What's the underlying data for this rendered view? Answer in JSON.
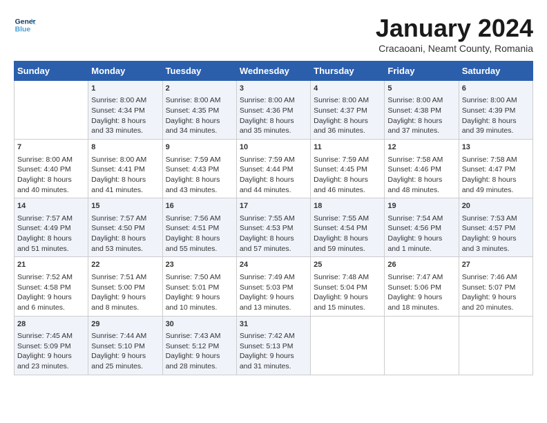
{
  "header": {
    "logo_line1": "General",
    "logo_line2": "Blue",
    "month_title": "January 2024",
    "subtitle": "Cracaoani, Neamt County, Romania"
  },
  "days_of_week": [
    "Sunday",
    "Monday",
    "Tuesday",
    "Wednesday",
    "Thursday",
    "Friday",
    "Saturday"
  ],
  "weeks": [
    [
      {
        "day": "",
        "content": ""
      },
      {
        "day": "1",
        "content": "Sunrise: 8:00 AM\nSunset: 4:34 PM\nDaylight: 8 hours\nand 33 minutes."
      },
      {
        "day": "2",
        "content": "Sunrise: 8:00 AM\nSunset: 4:35 PM\nDaylight: 8 hours\nand 34 minutes."
      },
      {
        "day": "3",
        "content": "Sunrise: 8:00 AM\nSunset: 4:36 PM\nDaylight: 8 hours\nand 35 minutes."
      },
      {
        "day": "4",
        "content": "Sunrise: 8:00 AM\nSunset: 4:37 PM\nDaylight: 8 hours\nand 36 minutes."
      },
      {
        "day": "5",
        "content": "Sunrise: 8:00 AM\nSunset: 4:38 PM\nDaylight: 8 hours\nand 37 minutes."
      },
      {
        "day": "6",
        "content": "Sunrise: 8:00 AM\nSunset: 4:39 PM\nDaylight: 8 hours\nand 39 minutes."
      }
    ],
    [
      {
        "day": "7",
        "content": "Sunrise: 8:00 AM\nSunset: 4:40 PM\nDaylight: 8 hours\nand 40 minutes."
      },
      {
        "day": "8",
        "content": "Sunrise: 8:00 AM\nSunset: 4:41 PM\nDaylight: 8 hours\nand 41 minutes."
      },
      {
        "day": "9",
        "content": "Sunrise: 7:59 AM\nSunset: 4:43 PM\nDaylight: 8 hours\nand 43 minutes."
      },
      {
        "day": "10",
        "content": "Sunrise: 7:59 AM\nSunset: 4:44 PM\nDaylight: 8 hours\nand 44 minutes."
      },
      {
        "day": "11",
        "content": "Sunrise: 7:59 AM\nSunset: 4:45 PM\nDaylight: 8 hours\nand 46 minutes."
      },
      {
        "day": "12",
        "content": "Sunrise: 7:58 AM\nSunset: 4:46 PM\nDaylight: 8 hours\nand 48 minutes."
      },
      {
        "day": "13",
        "content": "Sunrise: 7:58 AM\nSunset: 4:47 PM\nDaylight: 8 hours\nand 49 minutes."
      }
    ],
    [
      {
        "day": "14",
        "content": "Sunrise: 7:57 AM\nSunset: 4:49 PM\nDaylight: 8 hours\nand 51 minutes."
      },
      {
        "day": "15",
        "content": "Sunrise: 7:57 AM\nSunset: 4:50 PM\nDaylight: 8 hours\nand 53 minutes."
      },
      {
        "day": "16",
        "content": "Sunrise: 7:56 AM\nSunset: 4:51 PM\nDaylight: 8 hours\nand 55 minutes."
      },
      {
        "day": "17",
        "content": "Sunrise: 7:55 AM\nSunset: 4:53 PM\nDaylight: 8 hours\nand 57 minutes."
      },
      {
        "day": "18",
        "content": "Sunrise: 7:55 AM\nSunset: 4:54 PM\nDaylight: 8 hours\nand 59 minutes."
      },
      {
        "day": "19",
        "content": "Sunrise: 7:54 AM\nSunset: 4:56 PM\nDaylight: 9 hours\nand 1 minute."
      },
      {
        "day": "20",
        "content": "Sunrise: 7:53 AM\nSunset: 4:57 PM\nDaylight: 9 hours\nand 3 minutes."
      }
    ],
    [
      {
        "day": "21",
        "content": "Sunrise: 7:52 AM\nSunset: 4:58 PM\nDaylight: 9 hours\nand 6 minutes."
      },
      {
        "day": "22",
        "content": "Sunrise: 7:51 AM\nSunset: 5:00 PM\nDaylight: 9 hours\nand 8 minutes."
      },
      {
        "day": "23",
        "content": "Sunrise: 7:50 AM\nSunset: 5:01 PM\nDaylight: 9 hours\nand 10 minutes."
      },
      {
        "day": "24",
        "content": "Sunrise: 7:49 AM\nSunset: 5:03 PM\nDaylight: 9 hours\nand 13 minutes."
      },
      {
        "day": "25",
        "content": "Sunrise: 7:48 AM\nSunset: 5:04 PM\nDaylight: 9 hours\nand 15 minutes."
      },
      {
        "day": "26",
        "content": "Sunrise: 7:47 AM\nSunset: 5:06 PM\nDaylight: 9 hours\nand 18 minutes."
      },
      {
        "day": "27",
        "content": "Sunrise: 7:46 AM\nSunset: 5:07 PM\nDaylight: 9 hours\nand 20 minutes."
      }
    ],
    [
      {
        "day": "28",
        "content": "Sunrise: 7:45 AM\nSunset: 5:09 PM\nDaylight: 9 hours\nand 23 minutes."
      },
      {
        "day": "29",
        "content": "Sunrise: 7:44 AM\nSunset: 5:10 PM\nDaylight: 9 hours\nand 25 minutes."
      },
      {
        "day": "30",
        "content": "Sunrise: 7:43 AM\nSunset: 5:12 PM\nDaylight: 9 hours\nand 28 minutes."
      },
      {
        "day": "31",
        "content": "Sunrise: 7:42 AM\nSunset: 5:13 PM\nDaylight: 9 hours\nand 31 minutes."
      },
      {
        "day": "",
        "content": ""
      },
      {
        "day": "",
        "content": ""
      },
      {
        "day": "",
        "content": ""
      }
    ]
  ]
}
